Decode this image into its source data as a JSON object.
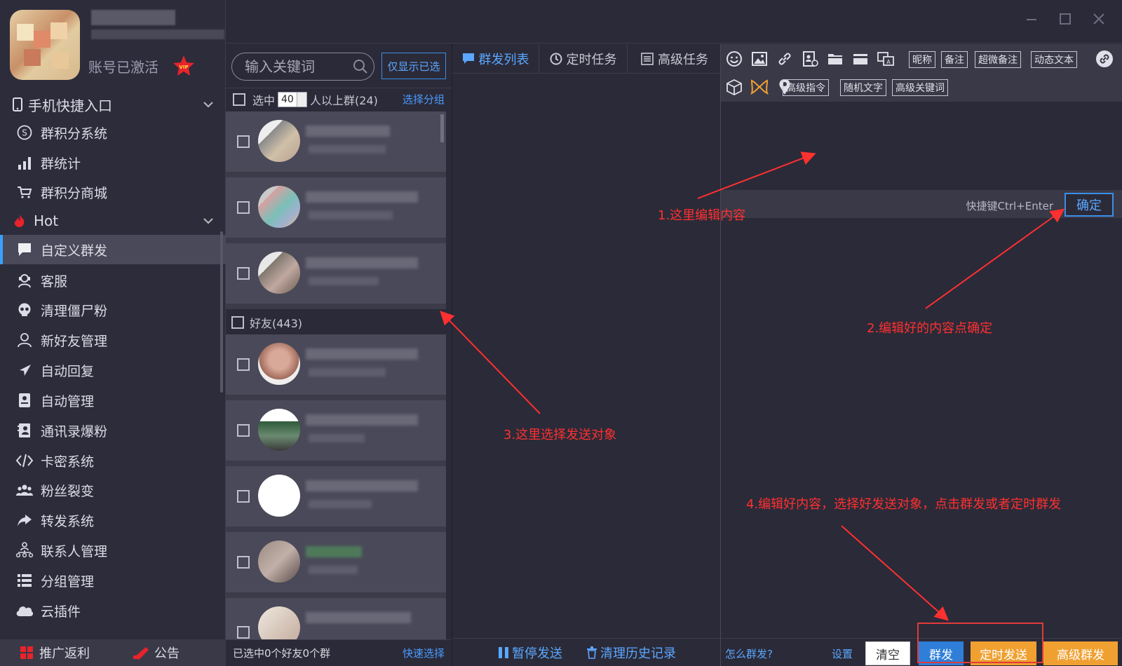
{
  "profile": {
    "status": "账号已激活",
    "vip_badge": "VIP"
  },
  "sidebar": {
    "groups": [
      {
        "label": "手机快捷入口",
        "icon": "phone-icon"
      },
      {
        "label": "Hot",
        "icon": "fire-icon"
      }
    ],
    "items": [
      {
        "label": "群积分系统",
        "icon": "coin-icon"
      },
      {
        "label": "群统计",
        "icon": "bar-chart-icon"
      },
      {
        "label": "群积分商城",
        "icon": "cart-icon"
      },
      {
        "label": "自定义群发",
        "icon": "chat-bubble-icon",
        "active": true
      },
      {
        "label": "客服",
        "icon": "headset-icon"
      },
      {
        "label": "清理僵尸粉",
        "icon": "skull-icon"
      },
      {
        "label": "新好友管理",
        "icon": "user-icon"
      },
      {
        "label": "自动回复",
        "icon": "send-icon"
      },
      {
        "label": "自动管理",
        "icon": "document-icon"
      },
      {
        "label": "通讯录爆粉",
        "icon": "contacts-book-icon"
      },
      {
        "label": "卡密系统",
        "icon": "code-icon"
      },
      {
        "label": "粉丝裂变",
        "icon": "group-icon"
      },
      {
        "label": "转发系统",
        "icon": "forward-icon"
      },
      {
        "label": "联系人管理",
        "icon": "org-chart-icon"
      },
      {
        "label": "分组管理",
        "icon": "list-icon"
      },
      {
        "label": "云插件",
        "icon": "cloud-icon"
      }
    ],
    "footer": [
      {
        "label": "推广返利",
        "icon": "grid-icon"
      },
      {
        "label": "公告",
        "icon": "megaphone-icon"
      }
    ]
  },
  "contacts": {
    "search_placeholder": "输入关键词",
    "only_selected": "仅显示已选",
    "select_label": "选中",
    "select_count": "40",
    "groups_label": "人以上群(24)",
    "choose_group": "选择分组",
    "friends_label": "好友(443)",
    "footer_status": "已选中0个好友0个群",
    "quick_select": "快速选择"
  },
  "tasks": {
    "tabs": [
      {
        "label": "群发列表",
        "icon": "chat-bubble-icon",
        "active": true
      },
      {
        "label": "定时任务",
        "icon": "clock-icon"
      },
      {
        "label": "高级任务",
        "icon": "list-box-icon"
      }
    ],
    "pause": "暂停发送",
    "clear_history": "清理历史记录"
  },
  "editor": {
    "tags_row1": [
      "昵称",
      "备注",
      "超微备注",
      "动态文本"
    ],
    "tags_row2": [
      "高级指令",
      "随机文字",
      "高级关键词"
    ],
    "shortcut": "快捷键Ctrl+Enter",
    "confirm": "确定",
    "how_link": "怎么群发?",
    "settings": "设置",
    "clear": "清空",
    "send": "群发",
    "timed_send": "定时发送",
    "advanced_send": "高级群发"
  },
  "annotations": {
    "a1": "1.这里编辑内容",
    "a2": "2.编辑好的内容点确定",
    "a3": "3.这里选择发送对象",
    "a4": "4.编辑好内容，选择好发送对象，点击群发或者定时群发"
  },
  "colors": {
    "accent": "#3a8fe8",
    "send_button": "#2f7fd8",
    "timed_button": "#f0a030",
    "annotation": "#ff3030"
  }
}
